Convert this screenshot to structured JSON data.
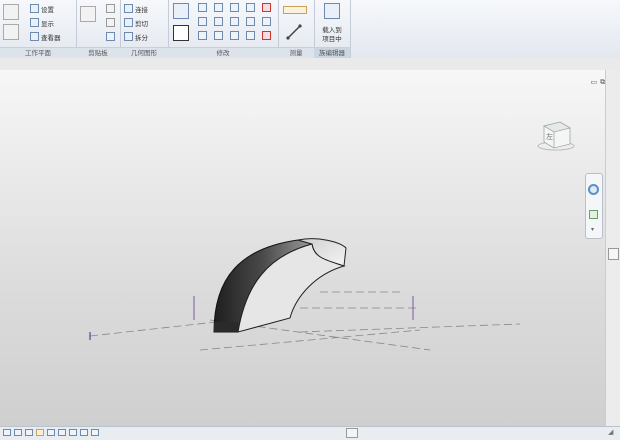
{
  "ribbon": {
    "panels": [
      {
        "label": "工作平面",
        "items": [
          "设置",
          "显示",
          "查看器"
        ]
      },
      {
        "label": "剪贴板",
        "items": []
      },
      {
        "label": "几何图形",
        "items": [
          "连接",
          "剪切",
          "拆分"
        ]
      },
      {
        "label": "修改",
        "items": []
      },
      {
        "label": "测量",
        "items": []
      },
      {
        "label": "族编辑器",
        "items": [
          "载入到",
          "项目中"
        ]
      }
    ]
  },
  "viewcube": {
    "face": "左"
  },
  "colors": {
    "ribbon_bg": "#e3e8ef",
    "viewport_top": "#f7f7f7",
    "viewport_bottom": "#cfcfcf",
    "accent": "#6d8bb0"
  }
}
